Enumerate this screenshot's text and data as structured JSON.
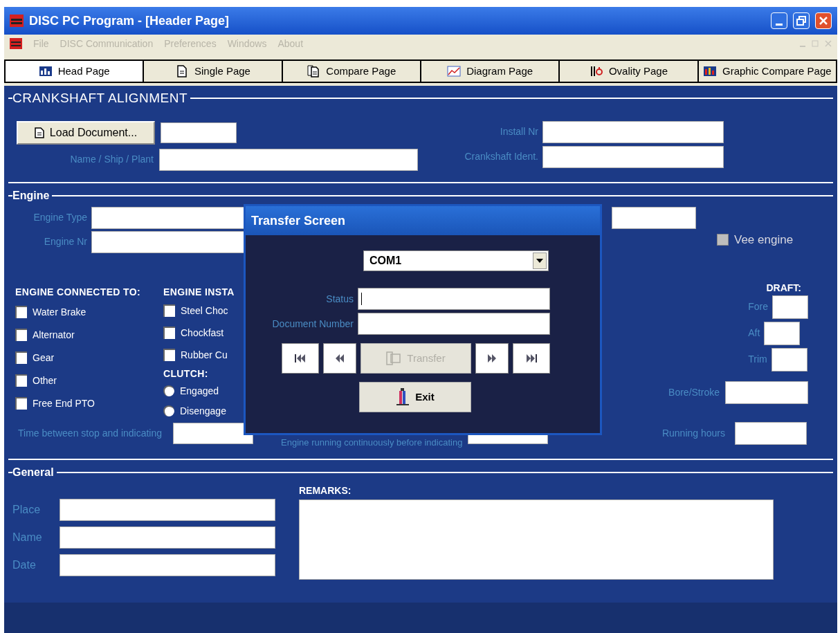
{
  "window": {
    "title": "DISC PC Program - [Header Page]"
  },
  "menu": [
    {
      "label": "File",
      "disabled": true
    },
    {
      "label": "DISC Communication",
      "disabled": true
    },
    {
      "label": "Preferences",
      "disabled": true
    },
    {
      "label": "Windows",
      "disabled": true
    },
    {
      "label": "About",
      "disabled": true
    }
  ],
  "tabs": [
    {
      "label": "Head Page",
      "selected": true
    },
    {
      "label": "Single Page",
      "selected": false
    },
    {
      "label": "Compare Page",
      "selected": false
    },
    {
      "label": "Diagram Page",
      "selected": false
    },
    {
      "label": "Ovality Page",
      "selected": false
    },
    {
      "label": "Graphic Compare Page",
      "selected": false
    }
  ],
  "crankshaft_alignment": {
    "title": "CRANKSHAFT ALIGNMENT",
    "load_button": "Load Document...",
    "name_label": "Name / Ship / Plant",
    "install_label": "Install Nr",
    "ident_label": "Crankshaft Ident."
  },
  "engine": {
    "title": "Engine",
    "type_label": "Engine Type",
    "nr_label": "Engine Nr",
    "vee_engine": {
      "label": "Vee engine",
      "checked": false,
      "disabled": true
    },
    "connected_to": {
      "heading": "ENGINE CONNECTED TO:",
      "options": [
        {
          "label": "Water Brake",
          "checked": false
        },
        {
          "label": "Alternator",
          "checked": false
        },
        {
          "label": "Gear",
          "checked": false
        },
        {
          "label": "Other",
          "checked": false
        },
        {
          "label": "Free End PTO",
          "checked": false
        }
      ]
    },
    "installation": {
      "heading": "ENGINE INSTA",
      "options": [
        {
          "label": "Steel Choc",
          "checked": false
        },
        {
          "label": "Chockfast",
          "checked": false
        },
        {
          "label": "Rubber Cu",
          "checked": false
        }
      ]
    },
    "clutch": {
      "heading": "CLUTCH:",
      "options": [
        {
          "label": "Engaged",
          "selected": false
        },
        {
          "label": "Disengage",
          "selected": false
        }
      ]
    },
    "draft": {
      "heading": "DRAFT:",
      "fields": [
        {
          "label": "Fore"
        },
        {
          "label": "Aft"
        },
        {
          "label": "Trim"
        }
      ]
    },
    "bore_stroke_label": "Bore/Stroke",
    "time_label": "Time between stop and indicating",
    "running_label": "Engine running continuously before indicating",
    "hours_label": "Running hours"
  },
  "general": {
    "title": "General",
    "fields": [
      {
        "label": "Place"
      },
      {
        "label": "Name"
      },
      {
        "label": "Date"
      }
    ],
    "remarks_label": "REMARKS:"
  },
  "transfer_dialog": {
    "title": "Transfer Screen",
    "port": "COM1",
    "status_label": "Status",
    "document_label": "Document Number",
    "transfer_button": {
      "label": "Transfer",
      "disabled": true
    },
    "exit_button": "Exit"
  }
}
